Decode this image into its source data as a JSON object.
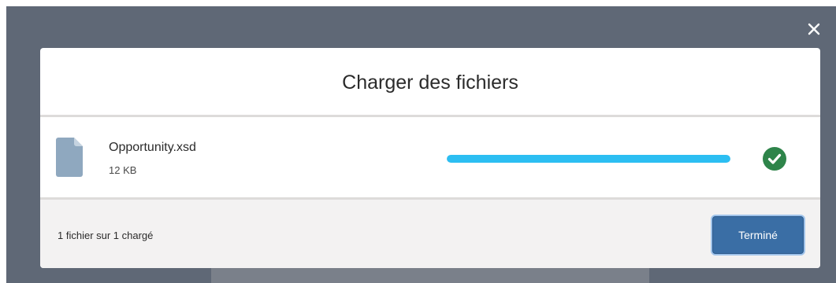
{
  "close_icon": "close-icon",
  "modal": {
    "title": "Charger des fichiers",
    "file": {
      "icon": "file-icon",
      "name": "Opportunity.xsd",
      "size": "12 KB",
      "progress_percent": 100,
      "status_icon": "check-circle-icon"
    },
    "footer": {
      "status_text": "1 fichier sur 1 chargé",
      "done_label": "Terminé"
    }
  },
  "colors": {
    "backdrop": "#5f6876",
    "progress_fill": "#2cbef2",
    "success": "#2e844a",
    "file_icon": "#8fa8bf",
    "brand_button": "#3a6ea5"
  }
}
